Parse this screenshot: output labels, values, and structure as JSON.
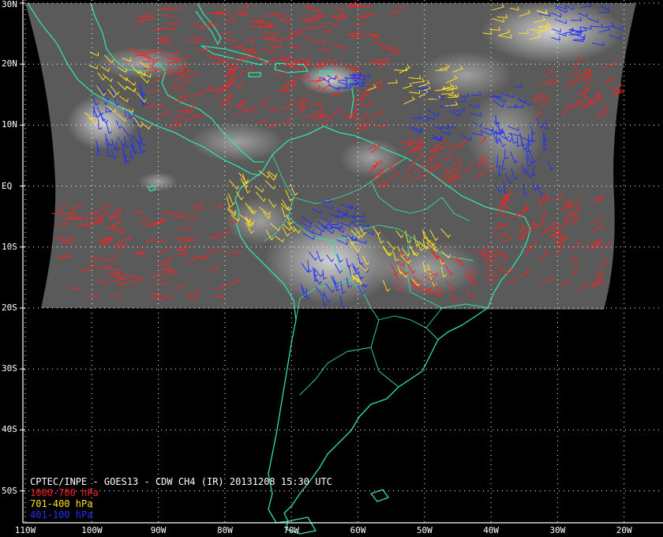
{
  "product": {
    "title_line": "CPTEC/INPE - GOES13 - CDW CH4 (IR) 20131208 15:30 UTC",
    "legend": [
      {
        "label": "1000-700 hPa",
        "color": "#ff2020"
      },
      {
        "label": "701-400 hPa",
        "color": "#ffe020"
      },
      {
        "label": "401-100 hPa",
        "color": "#2030ff"
      }
    ],
    "colors": {
      "coast": "#33e0a8",
      "grid": "#ffffff",
      "background": "#000000",
      "text": "#ffffff"
    }
  },
  "axes": {
    "lat_labels": [
      "30N",
      "20N",
      "10N",
      "EQ",
      "10S",
      "20S",
      "30S",
      "40S",
      "50S"
    ],
    "lon_labels": [
      "110W",
      "100W",
      "90W",
      "80W",
      "70W",
      "60W",
      "50W",
      "40W",
      "30W",
      "20W"
    ],
    "lat_values": [
      30,
      20,
      10,
      0,
      -10,
      -20,
      -30,
      -40,
      -50
    ],
    "lon_values": [
      -110,
      -100,
      -90,
      -80,
      -70,
      -60,
      -50,
      -40,
      -30,
      -20
    ],
    "lat_range": [
      -55,
      30
    ],
    "lon_range": [
      -110,
      -15
    ],
    "grid": true,
    "grid_style": "dotted"
  },
  "map": {
    "satellite_coverage": "approx. 107W-25W, 30N-20S (GOES-13 infrared imagery)",
    "coverage_lat_range": [
      -20,
      30
    ],
    "wind_barbs": "Cloud-drift wind vectors color-coded by pressure layer"
  }
}
